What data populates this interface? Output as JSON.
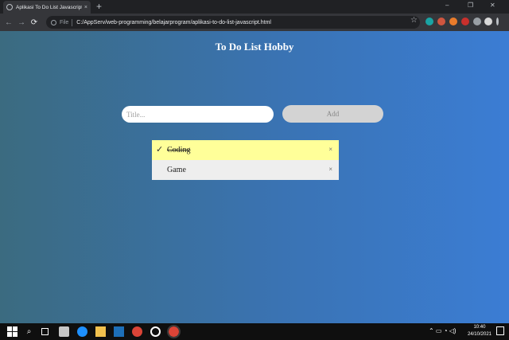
{
  "browser": {
    "tab_title": "Aplikasi To Do List Javascript",
    "tab_close": "×",
    "new_tab": "+",
    "window_controls": [
      "–",
      "❐",
      "✕"
    ],
    "url_scheme": "File",
    "url": "C:/AppServ/web-programming/belajarprogram/aplikasi-to-do-list-javascript.html",
    "nav": {
      "back": "←",
      "forward": "→",
      "reload": "⟳"
    }
  },
  "page": {
    "heading": "To Do List Hobby",
    "input_placeholder": "Title...",
    "add_label": "Add",
    "items": [
      {
        "label": "Coding",
        "checked": true,
        "check_glyph": "✓",
        "delete_glyph": "×"
      },
      {
        "label": "Game",
        "checked": false,
        "delete_glyph": "×"
      }
    ]
  },
  "taskbar": {
    "time": "10:40",
    "date": "24/10/2021"
  },
  "colors": {
    "checked_item_bg": "#ffff99",
    "unchecked_item_bg": "#eeeeee",
    "gradient_left": "#3b6b80",
    "gradient_right": "#3b7dd4"
  }
}
